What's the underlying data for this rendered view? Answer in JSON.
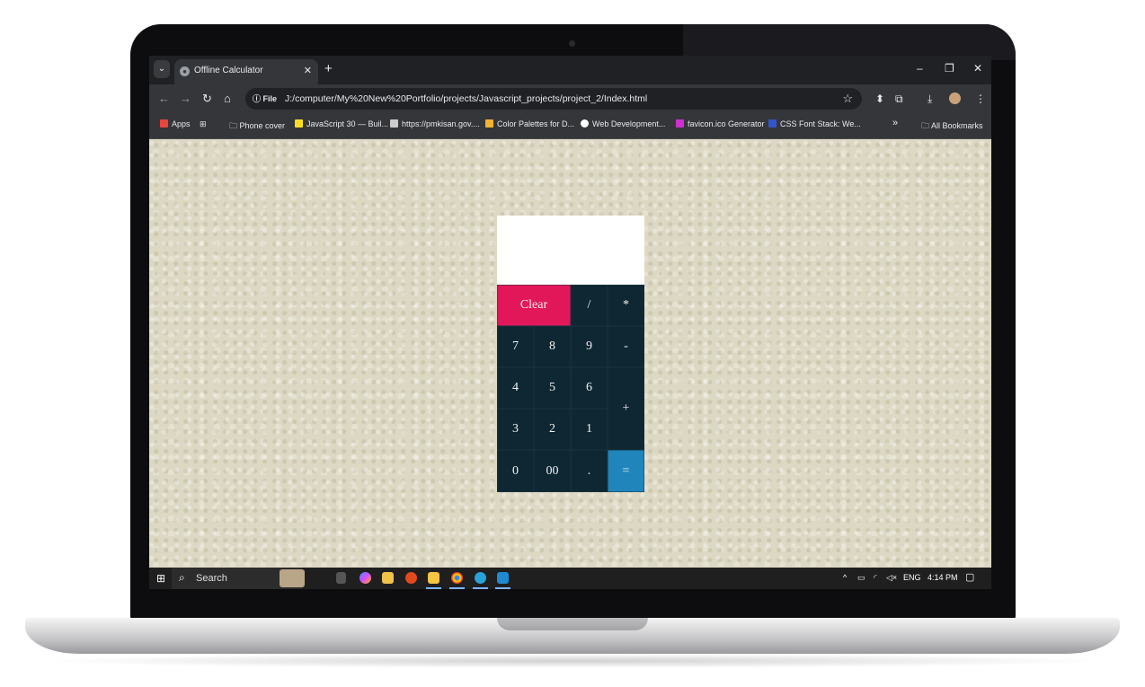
{
  "browser": {
    "tab_title": "Offline Calculator",
    "new_tab": "+",
    "omnibox_scheme": "File",
    "url": "J:/computer/My%20New%20Portfolio/projects/Javascript_projects/project_2/Index.html",
    "window_controls": [
      "–",
      "❐",
      "✕"
    ]
  },
  "bookmarks": [
    {
      "label": "Apps",
      "icon": "apps-grid-icon",
      "color": "#e8453c"
    },
    {
      "label": "Phone cover",
      "icon": "folder-icon"
    },
    {
      "label": "JavaScript 30 — Buil...",
      "icon": "js30-icon",
      "color": "#f7df1e"
    },
    {
      "label": "https://pmkisan.gov....",
      "icon": "site-icon",
      "color": "#cccccc"
    },
    {
      "label": "Color Palettes for D...",
      "icon": "palette-icon",
      "color": "#f2b233"
    },
    {
      "label": "Web Development...",
      "icon": "web-icon",
      "color": "#ffffff"
    },
    {
      "label": "favicon.ico Generator",
      "icon": "favicon-icon",
      "color": "#d22fd2"
    },
    {
      "label": "CSS Font Stack: We...",
      "icon": "css-icon",
      "color": "#3355cc"
    }
  ],
  "bookmarks_more": "»",
  "all_bookmarks": "All Bookmarks",
  "calculator": {
    "display_value": "",
    "keys": [
      "Clear",
      "/",
      "*",
      "7",
      "8",
      "9",
      "-",
      "4",
      "5",
      "6",
      "+",
      "3",
      "2",
      "1",
      "0",
      "00",
      ".",
      "="
    ],
    "colors": {
      "clear": "#e2175a",
      "equal": "#1f85bb",
      "keypad": "#0e2733"
    }
  },
  "taskbar": {
    "search_label": "Search",
    "language": "ENG",
    "time": "4:14 PM"
  }
}
